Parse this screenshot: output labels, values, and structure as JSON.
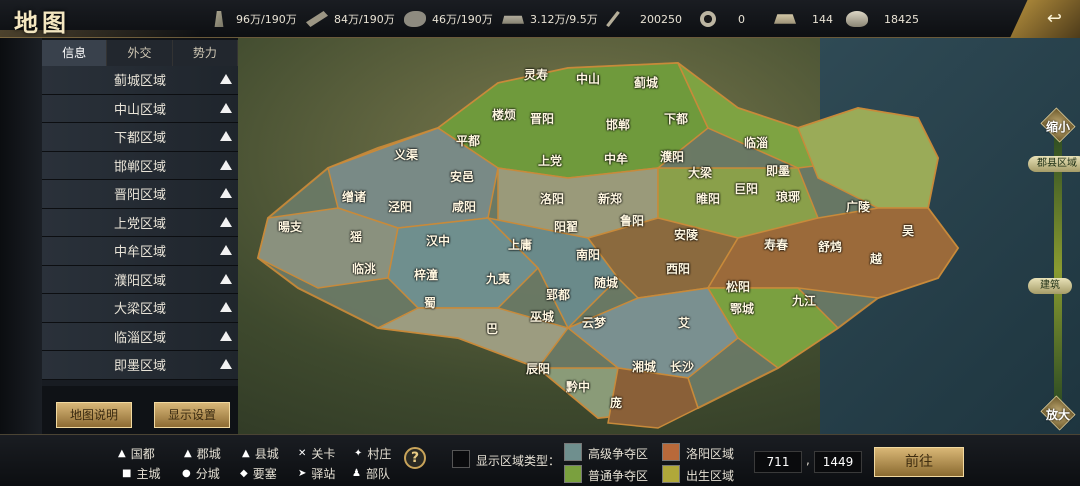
{
  "header": {
    "title": "地图"
  },
  "resources": [
    {
      "icon": "grain-icon",
      "cls": "grain",
      "value": "96万/190万"
    },
    {
      "icon": "wood-icon",
      "cls": "wood",
      "value": "84万/190万"
    },
    {
      "icon": "stone-icon",
      "cls": "stone",
      "value": "46万/190万"
    },
    {
      "icon": "iron-icon",
      "cls": "iron",
      "value": "3.12万/9.5万"
    },
    {
      "icon": "feather-icon",
      "cls": "feather",
      "value": "200250"
    },
    {
      "icon": "coin-icon",
      "cls": "coin",
      "value": "0"
    },
    {
      "icon": "gold-ingot-icon",
      "cls": "gold",
      "value": "144"
    },
    {
      "icon": "silver-ingot-icon",
      "cls": "ingot",
      "value": "18425"
    }
  ],
  "sidebar": {
    "tabs": [
      "信息",
      "外交",
      "势力"
    ],
    "collapse_icon": "‹",
    "regions": [
      "蓟城区域",
      "中山区域",
      "下都区域",
      "邯郸区域",
      "晋阳区域",
      "上党区域",
      "中牟区域",
      "濮阳区域",
      "大梁区域",
      "临淄区域",
      "即墨区域"
    ],
    "map_help_label": "地图说明",
    "display_settings_label": "显示设置"
  },
  "map": {
    "cities": [
      "灵寿",
      "中山",
      "蓟城",
      "楼烦",
      "晋阳",
      "邯郸",
      "下都",
      "平都",
      "上党",
      "中牟",
      "濮阳",
      "临淄",
      "义渠",
      "安邑",
      "大梁",
      "即墨",
      "缯诸",
      "洛阳",
      "新郑",
      "琅琊",
      "泾阳",
      "咸阳",
      "睢阳",
      "巨阳",
      "广陵",
      "暘支",
      "猺",
      "汉中",
      "上庸",
      "阳翟",
      "鲁阳",
      "安陵",
      "寿春",
      "舒鸩",
      "吴",
      "临洮",
      "梓潼",
      "九夷",
      "南阳",
      "西阳",
      "越",
      "蜀",
      "郢都",
      "随城",
      "松阳",
      "鄂城",
      "九江",
      "巴",
      "巫城",
      "云梦",
      "艾",
      "辰阳",
      "黔中",
      "湘城",
      "长沙",
      "庞"
    ]
  },
  "zoom": {
    "shrink_label": "缩小",
    "expand_label": "放大",
    "tag_county": "郡县区域",
    "tag_building": "建筑"
  },
  "legend": {
    "items": [
      {
        "glyph": "▲",
        "label": "国都"
      },
      {
        "glyph": "▲",
        "label": "郡城"
      },
      {
        "glyph": "▲",
        "label": "县城"
      },
      {
        "glyph": "✕",
        "label": "关卡"
      },
      {
        "glyph": "✦",
        "label": "村庄"
      },
      {
        "glyph": "■",
        "label": "主城"
      },
      {
        "glyph": "●",
        "label": "分城"
      },
      {
        "glyph": "◆",
        "label": "要塞"
      },
      {
        "glyph": "➤",
        "label": "驿站"
      },
      {
        "glyph": "♟",
        "label": "部队"
      }
    ],
    "help_glyph": "?",
    "display_type_label": "显示区域类型：",
    "zone_types": [
      {
        "label": "高级争夺区",
        "color": "#6f8f8e"
      },
      {
        "label": "洛阳区域",
        "color": "#b8693a"
      },
      {
        "label": "普通争夺区",
        "color": "#7aa03e"
      },
      {
        "label": "出生区域",
        "color": "#b0a83a"
      }
    ]
  },
  "coordinates": {
    "x": "711",
    "y": "1449"
  },
  "goto_label": "前往",
  "colors": {
    "accent_gold": "#c9a45a",
    "zone_green": "#7aa03e",
    "zone_blue": "#6f8f8e",
    "zone_brown": "#9a6a3a"
  }
}
